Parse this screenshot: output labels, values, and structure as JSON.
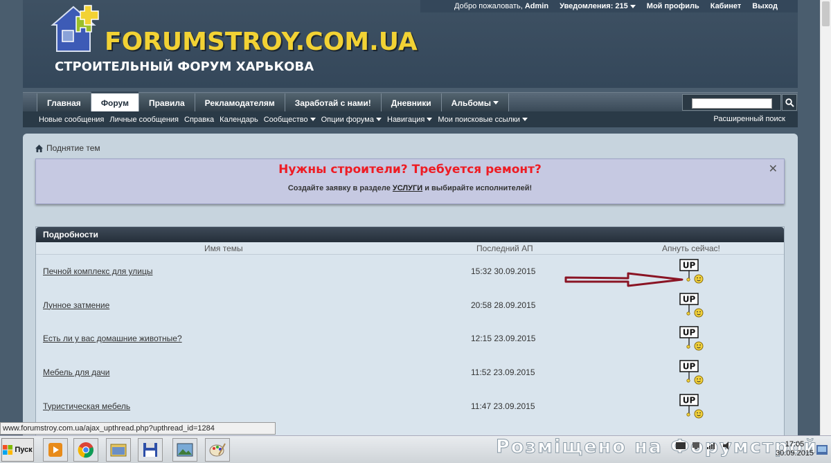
{
  "site": {
    "logo_text": "FORUMSTROY.COM.UA",
    "logo_subtitle": "СТРОИТЕЛЬНЫЙ ФОРУМ ХАРЬКОВА"
  },
  "userbar": {
    "welcome": "Добро пожаловать,",
    "username": "Admin",
    "notifications": "Уведомления: 215",
    "profile": "Мой профиль",
    "cabinet": "Кабинет",
    "logout": "Выход"
  },
  "tabs": [
    {
      "label": "Главная"
    },
    {
      "label": "Форум",
      "active": true
    },
    {
      "label": "Правила"
    },
    {
      "label": "Рекламодателям"
    },
    {
      "label": "Заработай с нами!"
    },
    {
      "label": "Дневники"
    },
    {
      "label": "Альбомы"
    }
  ],
  "subnav": [
    {
      "label": "Новые сообщения"
    },
    {
      "label": "Личные сообщения"
    },
    {
      "label": "Справка"
    },
    {
      "label": "Календарь"
    },
    {
      "label": "Сообщество",
      "dropdown": true
    },
    {
      "label": "Опции форума",
      "dropdown": true
    },
    {
      "label": "Навигация",
      "dropdown": true
    },
    {
      "label": "Мои поисковые ссылки",
      "dropdown": true
    }
  ],
  "search": {
    "placeholder": "",
    "advanced": "Расширенный поиск"
  },
  "breadcrumb": {
    "current": "Поднятие тем"
  },
  "notice": {
    "title": "Нужны строители? Требуется ремонт?",
    "text_before": "Создайте заявку в разделе",
    "link": "УСЛУГИ",
    "text_after": "и выбирайте исполнителей!"
  },
  "details": {
    "header": "Подробности",
    "columns": [
      "Имя темы",
      "Последний АП",
      "Апнуть сейчас!"
    ],
    "up_label": "UP",
    "rows": [
      {
        "topic": "Печной комплекс для улицы",
        "time": "15:32 30.09.2015"
      },
      {
        "topic": "Лунное затмение",
        "time": "20:58 28.09.2015"
      },
      {
        "topic": "Есть ли у вас домашние животные?",
        "time": "12:15 23.09.2015"
      },
      {
        "topic": "Мебель для дачи",
        "time": "11:52 23.09.2015"
      },
      {
        "topic": "Туристическая мебель",
        "time": "11:47 23.09.2015"
      }
    ]
  },
  "statusbar": {
    "url": "www.forumstroy.com.ua/ajax_upthread.php?upthread_id=1284"
  },
  "taskbar": {
    "start": "Пуск",
    "watermark": "Розміщено на Форумстрой",
    "time": "17:05",
    "date": "30.09.2015"
  },
  "colors": {
    "notice_title": "#ee1c24",
    "logo_yellow": "#f2d234",
    "header_bg": "#3e5163",
    "content_bg": "#c7d4de"
  }
}
